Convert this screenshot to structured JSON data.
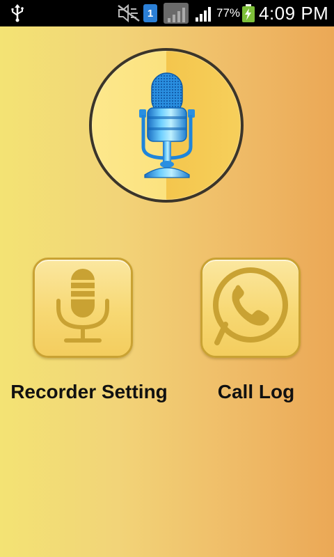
{
  "status_bar": {
    "sim_slot": "1",
    "battery_percent": "77%",
    "time": "4:09 PM",
    "icons": [
      "usb-icon",
      "mute-icon",
      "sim-icon",
      "data-icon",
      "signal-icon",
      "battery-charging-icon"
    ]
  },
  "main": {
    "hero_icon": "microphone-icon",
    "tiles": [
      {
        "label": "Recorder Setting",
        "icon": "microphone-icon"
      },
      {
        "label": "Call Log",
        "icon": "phone-icon"
      }
    ]
  },
  "colors": {
    "tile_icon": "#c9a233",
    "background_left": "#f3e374",
    "background_right": "#eba856"
  }
}
